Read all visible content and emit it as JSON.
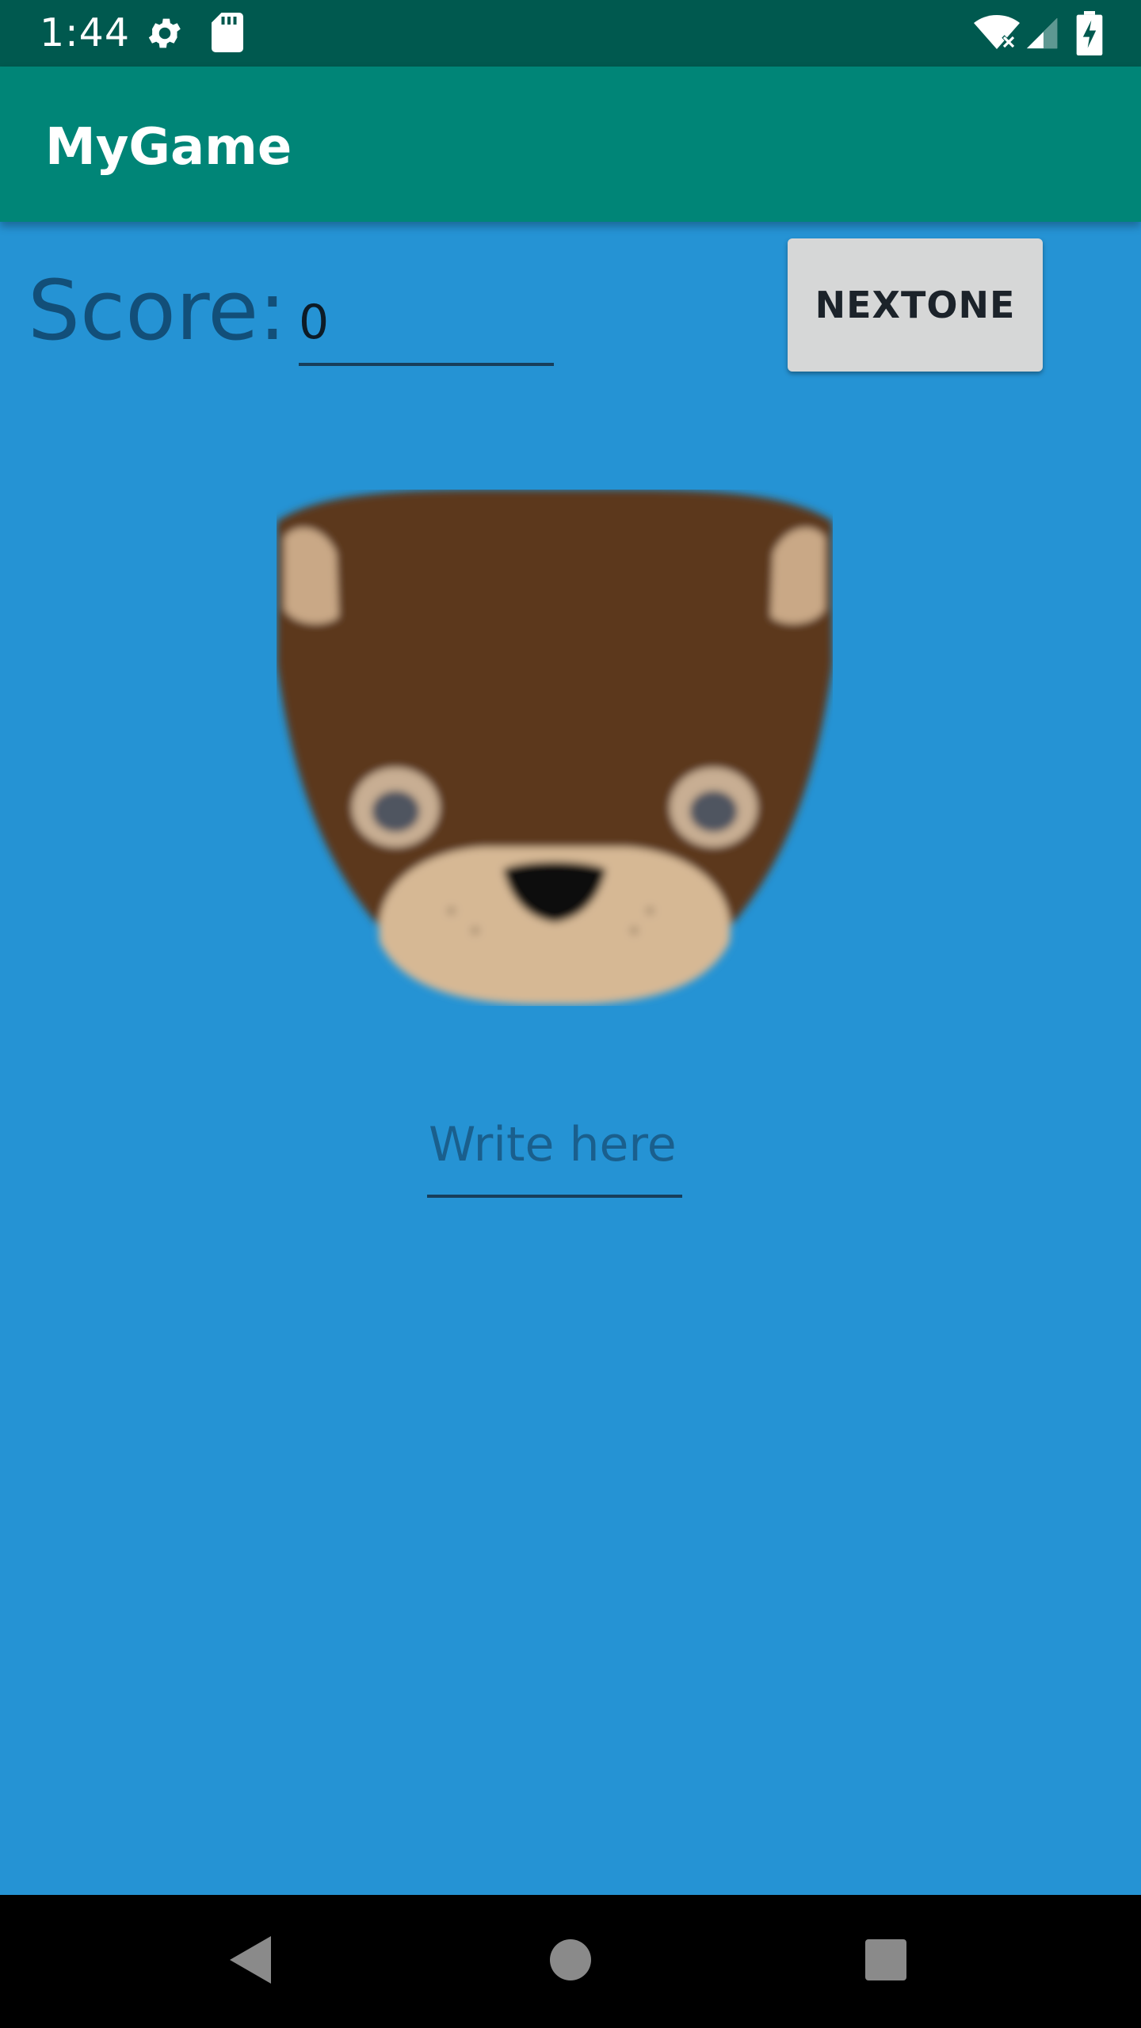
{
  "status_bar": {
    "time": "1:44",
    "icons": [
      "gear-icon",
      "sd-card-icon",
      "wifi-icon",
      "signal-icon",
      "battery-charging-icon"
    ]
  },
  "app_bar": {
    "title": "MyGame"
  },
  "game": {
    "score_label": "Score:",
    "score_value": "0",
    "next_button_label": "NEXTONE",
    "image": "otter-face-icon",
    "answer_placeholder": "Write here",
    "answer_value": ""
  },
  "nav_bar": {
    "icons": [
      "back-icon",
      "home-icon",
      "recents-icon"
    ]
  },
  "colors": {
    "background": "#2593d4",
    "status_bar": "#00594f",
    "app_bar": "#008577",
    "button": "#d6d7d7"
  }
}
